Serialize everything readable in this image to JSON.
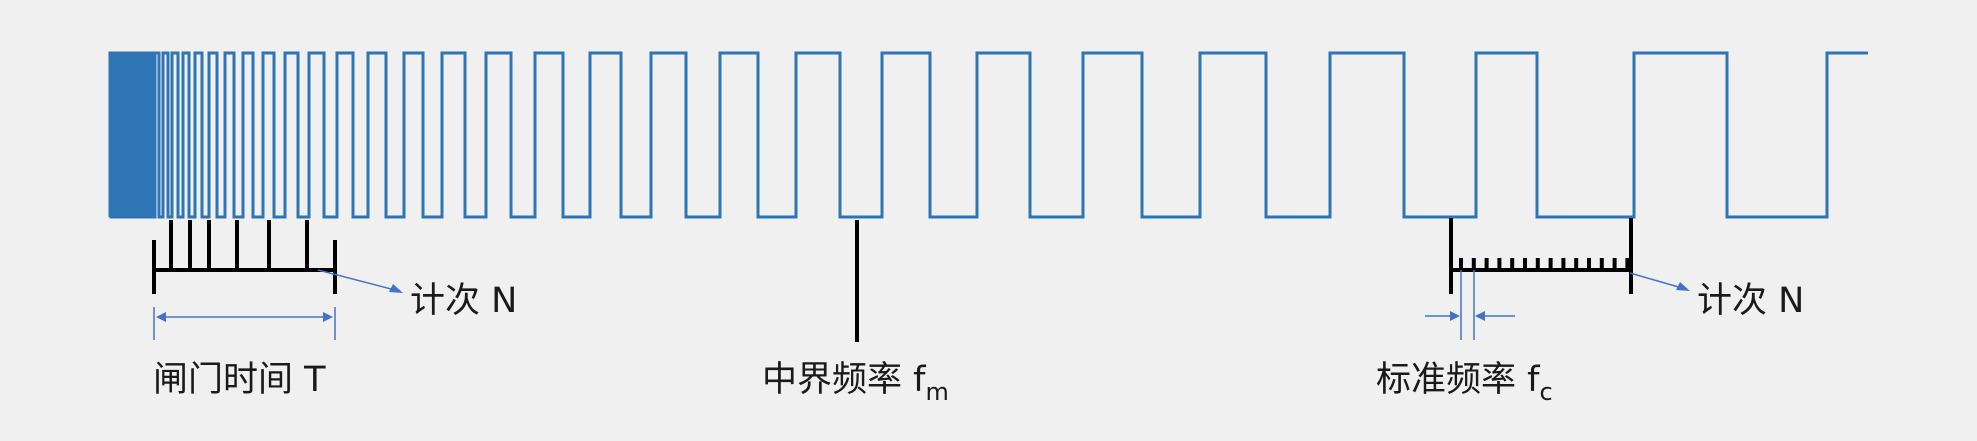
{
  "colors": {
    "background": "#f0f0f0",
    "waveform": "#2e75b6",
    "ticks": "#000000",
    "annotation": "#4472c4",
    "text": "#1a1a1a"
  },
  "labels": {
    "count_left": "计次 N",
    "gate_time": "闸门时间 T",
    "mid_freq_main": "中界频率 f",
    "mid_freq_sub": "m",
    "count_right": "计次 N",
    "std_freq_main": "标准频率 f",
    "std_freq_sub": "c"
  }
}
